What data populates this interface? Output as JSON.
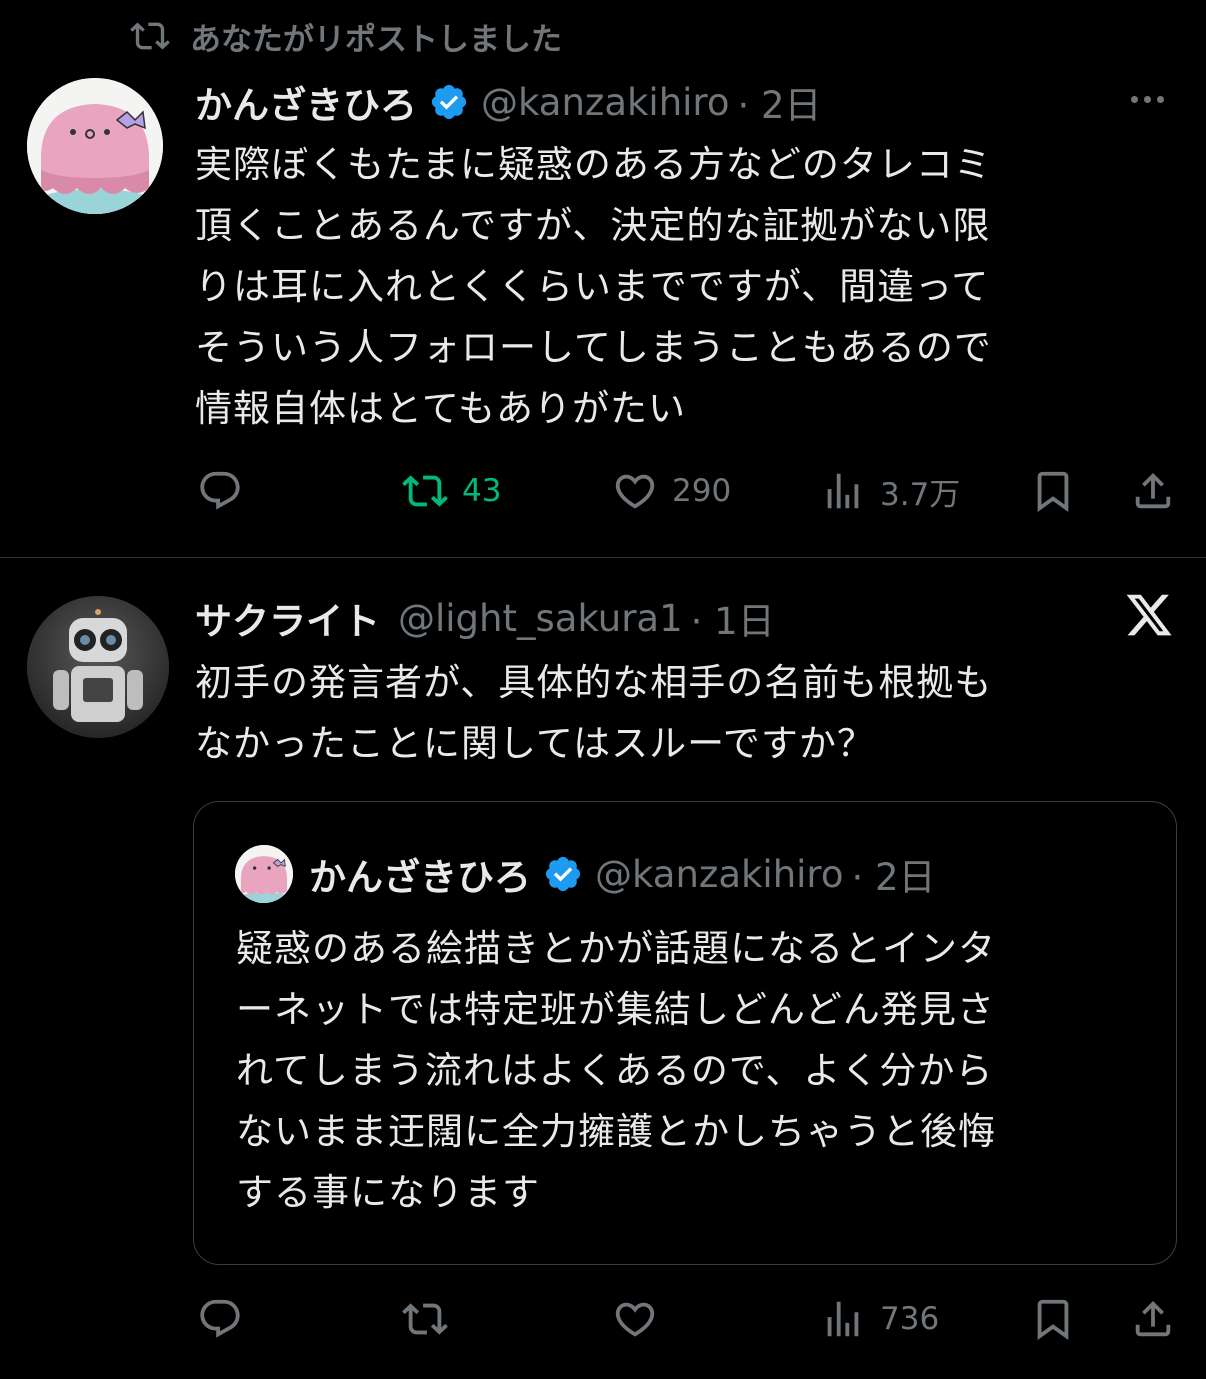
{
  "retweet_banner": {
    "text": "あなたがリポストしました",
    "icon": "repost-icon"
  },
  "tweet1": {
    "author_name": "かんざきひろ",
    "handle": "@kanzakihiro",
    "time": "· 2日",
    "verified": true,
    "text": "実際ぼくもたまに疑惑のある方などのタレコミ\n頂くことあるんですが、決定的な証拠がない限\nりは耳に入れとくくらいまでですが、間違って\nそういう人フォローしてしまうこともあるので\n情報自体はとてもありがたい",
    "actions": {
      "reply_count": "",
      "repost_count": "43",
      "like_count": "290",
      "views_count": "3.7万"
    },
    "repost_active_color": "#00ba7c"
  },
  "tweet2": {
    "author_name": "サクライト",
    "handle": "@light_sakura1",
    "time": "· 1日",
    "text": "初手の発言者が、具体的な相手の名前も根拠も\nなかったことに関してはスルーですか？",
    "quote": {
      "author_name": "かんざきひろ",
      "handle": "@kanzakihiro",
      "time": "· 2日",
      "verified": true,
      "text": "疑惑のある絵描きとかが話題になるとインタ\nーネットでは特定班が集結しどんどん発見さ\nれてしまう流れはよくあるので、よく分から\nないまま迂闊に全力擁護とかしちゃうと後悔\nする事になります"
    },
    "actions": {
      "views_count": "736"
    }
  },
  "colors": {
    "background": "#000000",
    "text": "#e7e9ea",
    "muted": "#71767b",
    "verified": "#1d9bf0",
    "divider": "#2f3336"
  }
}
